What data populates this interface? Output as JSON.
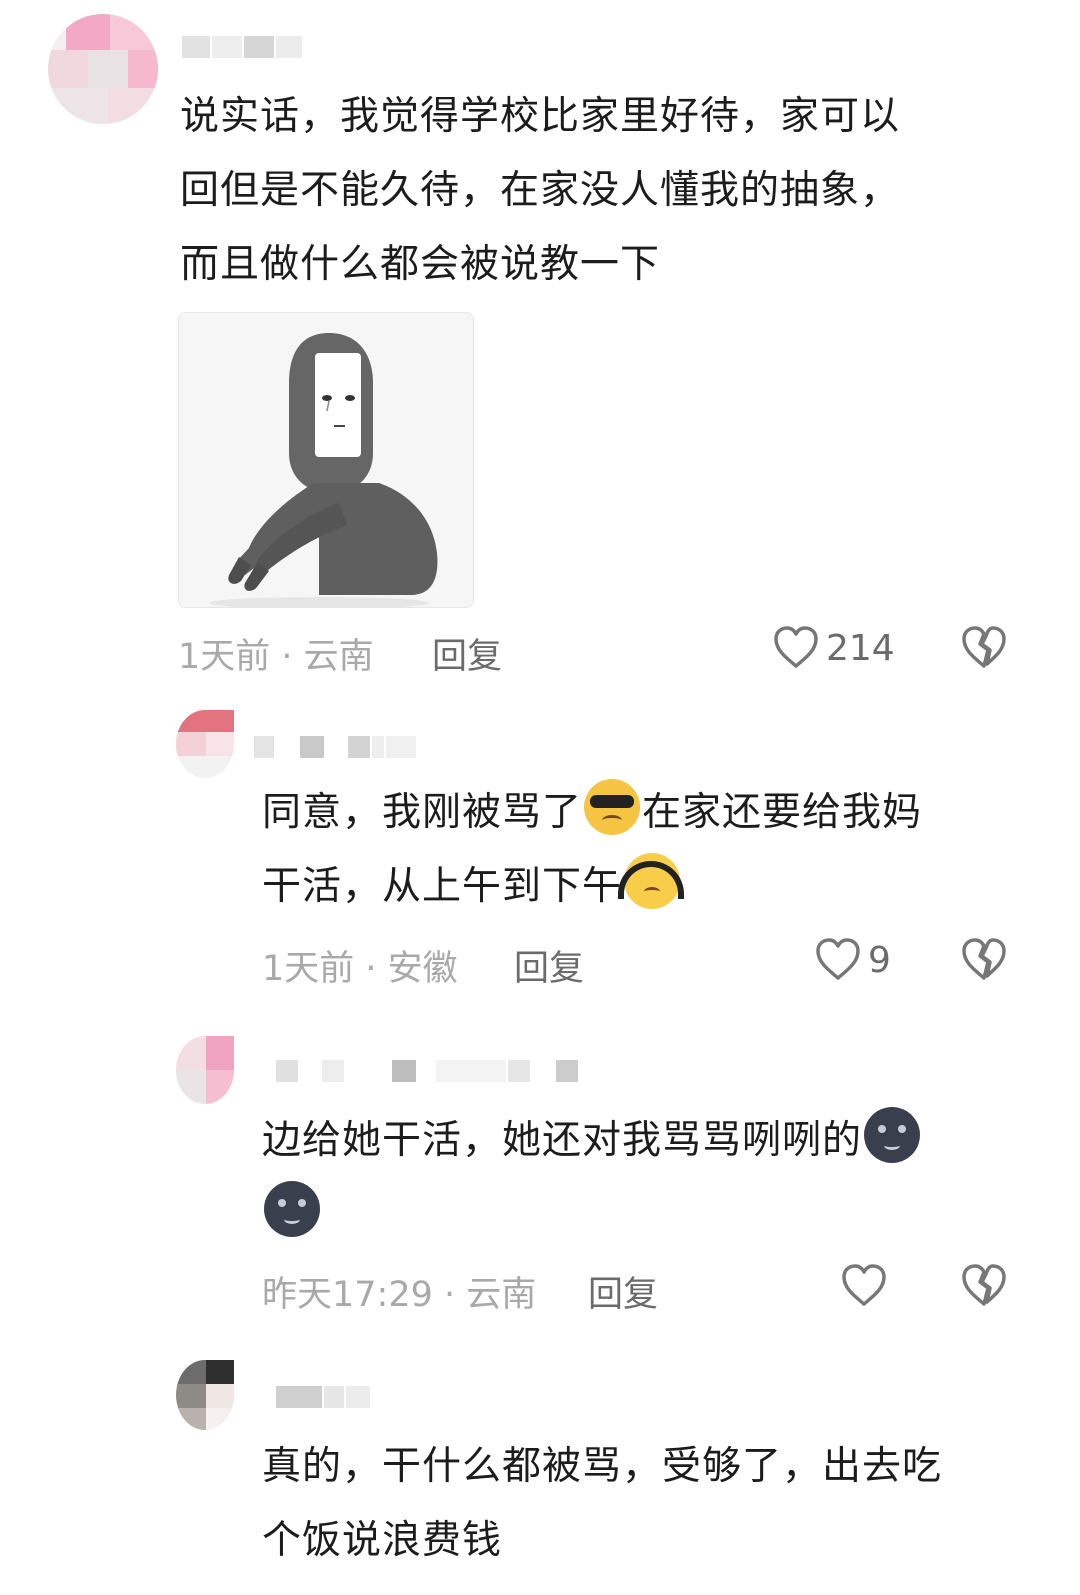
{
  "comments": [
    {
      "text_lines": [
        "说实话，我觉得学校比家里好待，家可以",
        "回但是不能久待，在家没人懂我的抽象，",
        "而且做什么都会被说教一下"
      ],
      "meta": "1天前 · 云南",
      "reply_label": "回复",
      "likes": "214"
    },
    {
      "text_lines": [
        "同意，我刚被骂了",
        "在家还要给我妈",
        "干活，从上午到下午"
      ],
      "meta": "1天前 · 安徽",
      "reply_label": "回复",
      "likes": "9"
    },
    {
      "text_lines": [
        "边给她干活，她还对我骂骂咧咧的"
      ],
      "meta": "昨天17:29 · 云南",
      "reply_label": "回复",
      "likes": ""
    },
    {
      "text_lines": [
        "真的，干什么都被骂，受够了，出去吃",
        "个饭说浪费钱"
      ]
    }
  ],
  "icons": {
    "like": "heart-outline-icon",
    "dislike": "broken-heart-icon",
    "emoji_cry": "crying-sunglasses-emoji",
    "emoji_headphone": "headphone-face-emoji",
    "emoji_moon": "new-moon-face-emoji"
  },
  "colors": {
    "text": "#1c1c1c",
    "meta": "#a9a9a9",
    "action": "#6b6b6b"
  }
}
